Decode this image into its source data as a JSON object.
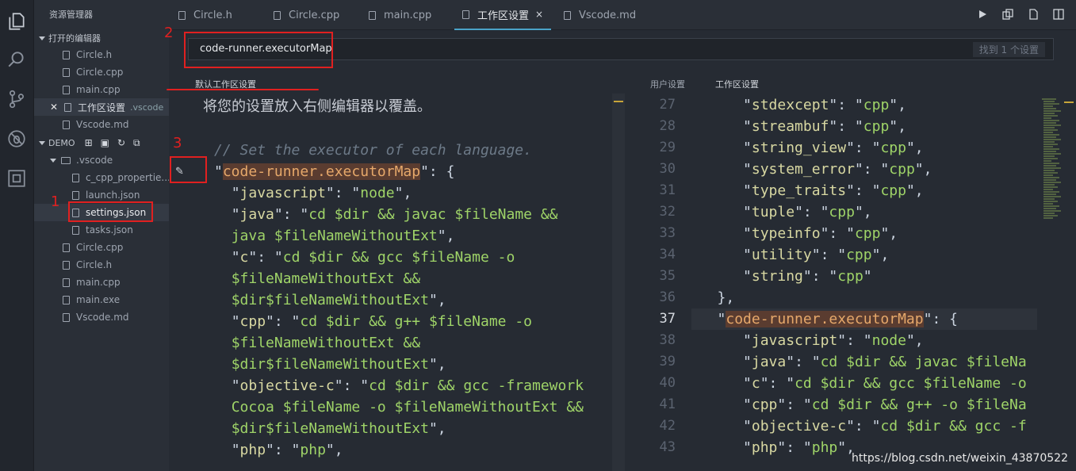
{
  "sidebar": {
    "title": "资源管理器",
    "open_editors_label": "打开的编辑器",
    "open_editors": [
      {
        "label": "Circle.h"
      },
      {
        "label": "Circle.cpp"
      },
      {
        "label": "main.cpp"
      },
      {
        "label": "工作区设置",
        "extra": ".vscode",
        "active": true
      },
      {
        "label": "Vscode.md"
      }
    ],
    "project_label": "DEMO",
    "vscode_folder": ".vscode",
    "vscode_files": [
      {
        "label": "c_cpp_propertie..."
      },
      {
        "label": "launch.json"
      },
      {
        "label": "settings.json"
      },
      {
        "label": "tasks.json"
      }
    ],
    "files": [
      {
        "label": "Circle.cpp"
      },
      {
        "label": "Circle.h"
      },
      {
        "label": "main.cpp"
      },
      {
        "label": "main.exe"
      },
      {
        "label": "Vscode.md"
      }
    ]
  },
  "tabs": [
    {
      "label": "Circle.h"
    },
    {
      "label": "Circle.cpp"
    },
    {
      "label": "main.cpp"
    },
    {
      "label": "工作区设置",
      "active": true,
      "close": "×"
    },
    {
      "label": "Vscode.md"
    }
  ],
  "search": {
    "value": "code-runner.executorMap",
    "result_count": "找到 1 个设置"
  },
  "left_pane": {
    "label": "默认工作区设置",
    "hint": "将您的设置放入右侧编辑器以覆盖。",
    "comment": "// Set the executor of each language.",
    "setting_key": "code-runner.executorMap",
    "entries": [
      {
        "k": "javascript",
        "v": "node"
      },
      {
        "k": "java",
        "v": "cd $dir && javac $fileName &&",
        "v2": "java $fileNameWithoutExt"
      },
      {
        "k": "c",
        "v": "cd $dir && gcc $fileName -o",
        "v2": "$fileNameWithoutExt &&",
        "v3": "$dir$fileNameWithoutExt"
      },
      {
        "k": "cpp",
        "v": "cd $dir && g++ $fileName -o",
        "v2": "$fileNameWithoutExt &&",
        "v3": "$dir$fileNameWithoutExt"
      },
      {
        "k": "objective-c",
        "v": "cd $dir && gcc -framework",
        "v2": "Cocoa $fileName -o $fileNameWithoutExt &&",
        "v3": "$dir$fileNameWithoutExt"
      },
      {
        "k": "php",
        "v": "php"
      }
    ]
  },
  "right_pane": {
    "tab_user": "用户设置",
    "tab_workspace": "工作区设置",
    "line_numbers": [
      "27",
      "28",
      "29",
      "30",
      "31",
      "32",
      "33",
      "34",
      "35",
      "36",
      "37",
      "38",
      "39",
      "40",
      "41",
      "42",
      "43"
    ],
    "current_line": "37",
    "entries_top": [
      {
        "k": "stdexcept",
        "v": "cpp"
      },
      {
        "k": "streambuf",
        "v": "cpp"
      },
      {
        "k": "string_view",
        "v": "cpp"
      },
      {
        "k": "system_error",
        "v": "cpp"
      },
      {
        "k": "type_traits",
        "v": "cpp"
      },
      {
        "k": "tuple",
        "v": "cpp"
      },
      {
        "k": "typeinfo",
        "v": "cpp"
      },
      {
        "k": "utility",
        "v": "cpp"
      },
      {
        "k": "string",
        "v": "cpp"
      }
    ],
    "close_brace": "},",
    "setting_key": "code-runner.executorMap",
    "entries_bottom": [
      {
        "k": "javascript",
        "v": "node"
      },
      {
        "k": "java",
        "v": "cd $dir && javac $fileNa"
      },
      {
        "k": "c",
        "v": "cd $dir && gcc $fileName -o"
      },
      {
        "k": "cpp",
        "v": "cd $dir && g++ -o $fileNa"
      },
      {
        "k": "objective-c",
        "v": "cd $dir && gcc -f"
      },
      {
        "k": "php",
        "v": "php"
      }
    ]
  },
  "annotations": [
    "1",
    "2",
    "3"
  ],
  "watermark": "https://blog.csdn.net/weixin_43870522",
  "colors": {
    "accent": "#4aa3c7",
    "annotation": "#e02020",
    "string": "#9fd468",
    "key": "#d8d8a2",
    "highlight": "#5a3c30"
  }
}
